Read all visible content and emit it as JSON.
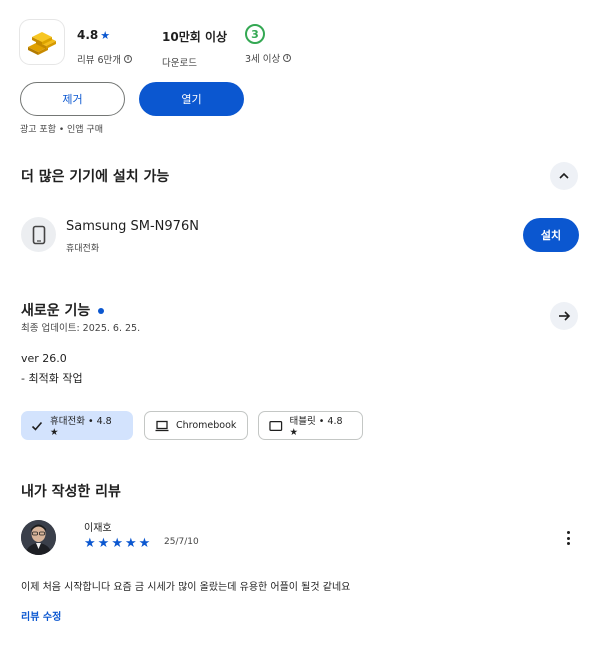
{
  "stats": {
    "rating": {
      "value": "4.8",
      "label": "리뷰 6만개"
    },
    "downloads": {
      "value": "10만회 이상",
      "label": "다운로드"
    },
    "age": {
      "badge": "3",
      "label": "3세 이상"
    }
  },
  "actions": {
    "uninstall_label": "제거",
    "open_label": "열기"
  },
  "ads_note": "광고 포함 • 인앱 구매",
  "more_devices": {
    "title": "더 많은 기기에 설치 가능",
    "device": {
      "name": "Samsung SM-N976N",
      "type": "휴대전화",
      "install_label": "설치"
    }
  },
  "whats_new": {
    "title": "새로운 기능",
    "updated": "최종 업데이트: 2025. 6. 25.",
    "version": "ver 26.0",
    "notes": "- 최적화 작업"
  },
  "chips": [
    {
      "label": "휴대전화 • 4.8 ★",
      "icon": "check-icon",
      "selected": true
    },
    {
      "label": "Chromebook",
      "icon": "laptop-icon",
      "selected": false
    },
    {
      "label": "태블릿 • 4.8 ★",
      "icon": "tablet-icon",
      "selected": false
    }
  ],
  "my_review": {
    "title": "내가 작성한 리뷰",
    "reviewer": "이재호",
    "rating": 5,
    "date": "25/7/10",
    "text": "이제 처음 시작합니다 요즘 금 시세가 많이 올랐는데 유용한 어플이 될것 같네요",
    "edit_label": "리뷰 수정"
  },
  "colors": {
    "accent": "#0b57d0",
    "age_badge": "#34a853",
    "chip_selected": "#d3e3fd"
  }
}
